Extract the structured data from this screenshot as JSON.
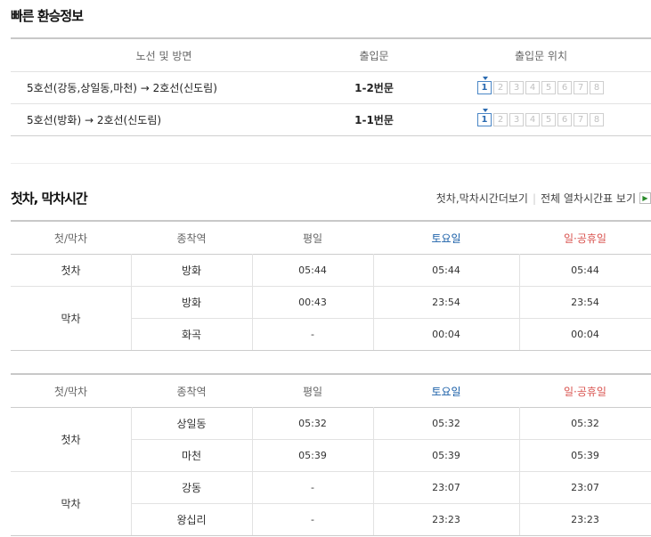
{
  "transfer": {
    "title": "빠른 환승정보",
    "headers": [
      "노선 및 방면",
      "출입문",
      "출입문 위치"
    ],
    "rows": [
      {
        "route": "5호선(강동,상일동,마천) → 2호선(신도림)",
        "door": "1-2번문",
        "active": 1
      },
      {
        "route": "5호선(방화) → 2호선(신도림)",
        "door": "1-1번문",
        "active": 1
      }
    ],
    "door_numbers": [
      "1",
      "2",
      "3",
      "4",
      "5",
      "6",
      "7",
      "8"
    ]
  },
  "timetable": {
    "title": "첫차, 막차시간",
    "link1": "첫차,막차시간더보기",
    "link2": "전체 열차시간표 보기",
    "headers": [
      "첫/막차",
      "종착역",
      "평일",
      "토요일",
      "일·공휴일"
    ],
    "colors": {
      "saturday": "#1a5fa8",
      "holiday": "#d9534f"
    },
    "table1": {
      "first_label": "첫차",
      "last_label": "막차",
      "rows": [
        {
          "station": "방화",
          "weekday": "05:44",
          "saturday": "05:44",
          "holiday": "05:44"
        },
        {
          "station": "방화",
          "weekday": "00:43",
          "saturday": "23:54",
          "holiday": "23:54"
        },
        {
          "station": "화곡",
          "weekday": "-",
          "saturday": "00:04",
          "holiday": "00:04"
        }
      ]
    },
    "table2": {
      "first_label": "첫차",
      "last_label": "막차",
      "rows": [
        {
          "station": "상일동",
          "weekday": "05:32",
          "saturday": "05:32",
          "holiday": "05:32"
        },
        {
          "station": "마천",
          "weekday": "05:39",
          "saturday": "05:39",
          "holiday": "05:39"
        },
        {
          "station": "강동",
          "weekday": "-",
          "saturday": "23:07",
          "holiday": "23:07"
        },
        {
          "station": "왕십리",
          "weekday": "-",
          "saturday": "23:23",
          "holiday": "23:23"
        }
      ]
    }
  }
}
